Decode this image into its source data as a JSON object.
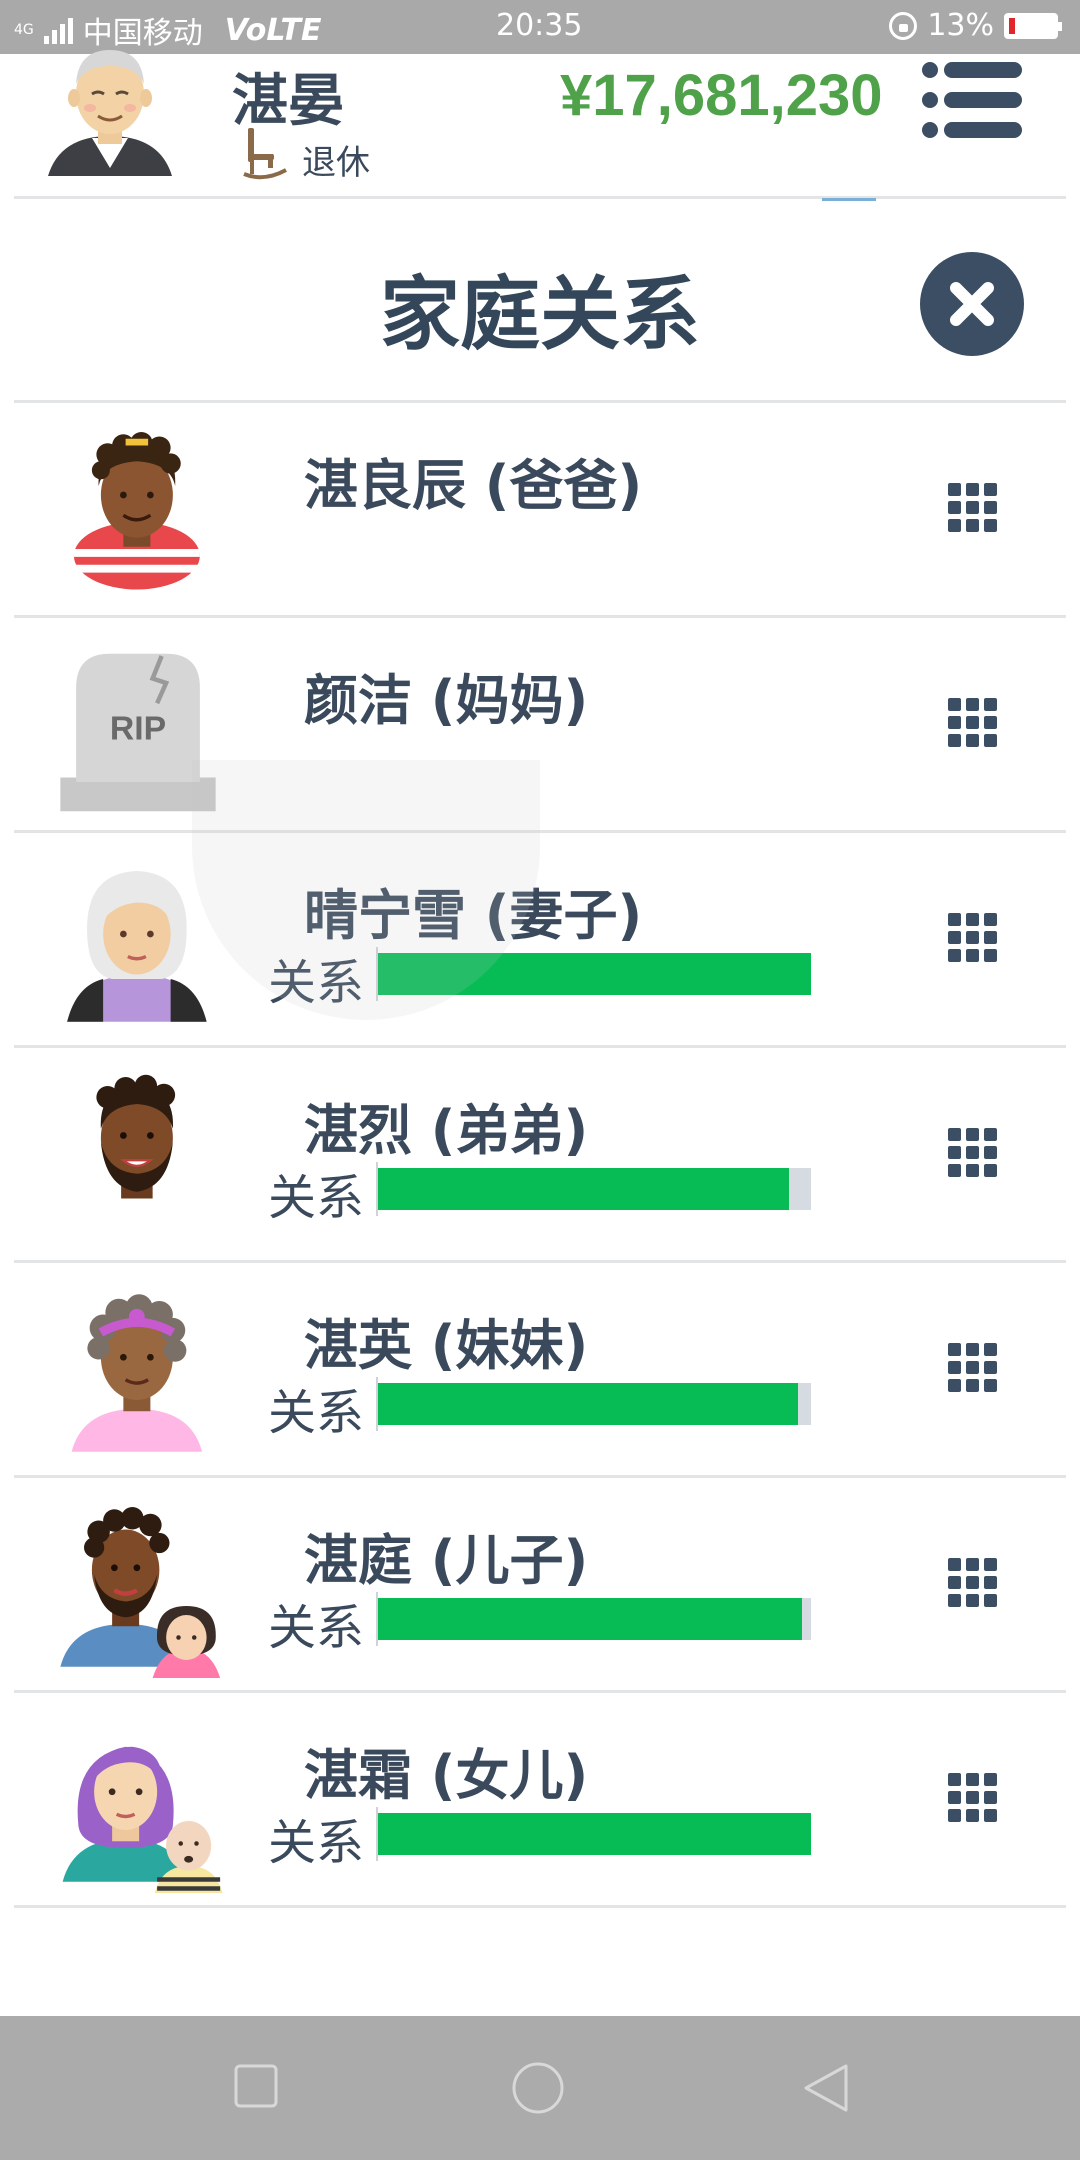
{
  "status_bar": {
    "network": "4G",
    "carrier": "中国移动",
    "volte": "VoLTE",
    "time": "20:35",
    "battery_percent": "13%",
    "battery_level": 0.13,
    "battery_color": "#e0262a"
  },
  "header": {
    "player_name": "湛晏",
    "status_label": "退休",
    "money": "¥17,681,230",
    "money_color": "#4fa24a"
  },
  "dialog": {
    "title": "家庭关系"
  },
  "relationship_label": "关系",
  "relatives": [
    {
      "name": "湛良辰 (爸爸)",
      "icon": "father-avatar-icon",
      "deceased": false,
      "has_bar": false
    },
    {
      "name": "颜洁 (妈妈)",
      "icon": "tombstone-rip-icon",
      "deceased": true,
      "tombstone_text": "RIP",
      "has_bar": false
    },
    {
      "name": "晴宁雪 (妻子)",
      "icon": "wife-avatar-icon",
      "has_bar": true,
      "relationship": 1.0
    },
    {
      "name": "湛烈 (弟弟)",
      "icon": "brother-avatar-icon",
      "has_bar": true,
      "relationship": 0.95
    },
    {
      "name": "湛英 (妹妹)",
      "icon": "sister-avatar-icon",
      "has_bar": true,
      "relationship": 0.97
    },
    {
      "name": "湛庭 (儿子)",
      "icon": "son-with-family-avatar-icon",
      "has_bar": true,
      "relationship": 0.98
    },
    {
      "name": "湛霜 (女儿)",
      "icon": "daughter-with-family-avatar-icon",
      "has_bar": true,
      "relationship": 1.0
    }
  ],
  "colors": {
    "bar_fill": "#07bb55",
    "bar_track": "#d5dbe0",
    "text_dark": "#3a4a5c",
    "close_button": "#3b4e63"
  },
  "nav_bar": {
    "buttons": [
      "recent-apps-icon",
      "home-icon",
      "back-icon"
    ]
  }
}
